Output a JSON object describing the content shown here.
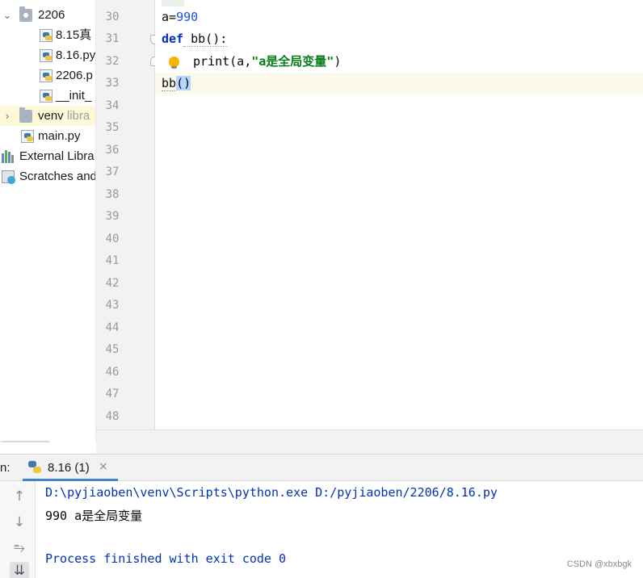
{
  "project_tree": {
    "items": [
      {
        "label": "2206",
        "sub": ""
      },
      {
        "label": "8.15真",
        "sub": ""
      },
      {
        "label": "8.16.py",
        "sub": ""
      },
      {
        "label": "2206.p",
        "sub": ""
      },
      {
        "label": "__init_",
        "sub": ""
      },
      {
        "label": "venv",
        "sub": "libra"
      },
      {
        "label": "main.py",
        "sub": ""
      },
      {
        "label": "External Libra",
        "sub": ""
      },
      {
        "label": "Scratches and",
        "sub": ""
      }
    ]
  },
  "editor": {
    "line_numbers": [
      "30",
      "31",
      "32",
      "33",
      "34",
      "35",
      "36",
      "37",
      "38",
      "39",
      "40",
      "41",
      "42",
      "43",
      "44",
      "45",
      "46",
      "47",
      "48"
    ],
    "code": {
      "line30_var": "a",
      "line30_eq": "=",
      "line30_num": "990",
      "line31_kw": "def",
      "line31_rest": " bb():",
      "line32_fn": "print",
      "line32_open": "(a,",
      "line32_str": "\"a是全局变量\"",
      "line32_close": ")",
      "line33_name": "bb",
      "line33_parens": "()"
    }
  },
  "run": {
    "label": "n:",
    "tab_label": "8.16 (1)",
    "tab_close": "×",
    "toolbar": {
      "up": "↑",
      "down": "↓",
      "wrap": "⥱",
      "scroll_end": "⇊"
    },
    "console": {
      "command": "D:\\pyjiaoben\\venv\\Scripts\\python.exe D:/pyjiaoben/2206/8.16.py",
      "output": "990 a是全局变量",
      "exit": "Process finished with exit code 0"
    }
  },
  "watermark": "CSDN @xbxbgk"
}
